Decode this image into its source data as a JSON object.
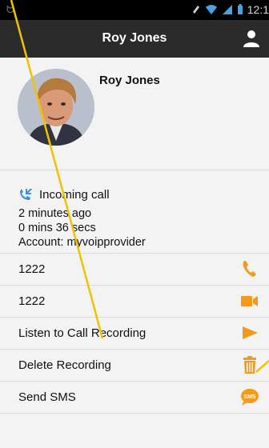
{
  "status_bar": {
    "time": "12:1",
    "icons": [
      "usb-icon",
      "mute-icon",
      "wifi-icon",
      "signal-icon",
      "battery-icon"
    ]
  },
  "header": {
    "title": "Roy Jones",
    "action_icon": "contact-person-icon"
  },
  "contact": {
    "name": "Roy Jones"
  },
  "call": {
    "type_label": "Incoming call",
    "time_ago": "2 minutes ago",
    "duration": "0 mins 36 secs",
    "account": "Account: myvoipprovider"
  },
  "actions": [
    {
      "label": "1222",
      "icon": "phone-icon"
    },
    {
      "label": "1222",
      "icon": "video-call-icon"
    },
    {
      "label": "Listen to Call Recording",
      "icon": "play-icon"
    },
    {
      "label": "Delete Recording",
      "icon": "trash-icon"
    },
    {
      "label": "Send SMS",
      "icon": "sms-icon"
    }
  ],
  "colors": {
    "accent": "#f39a1e",
    "call_icon": "#3d8fe0",
    "header_bg": "#2b2b2b",
    "annotation": "#f2c200"
  }
}
